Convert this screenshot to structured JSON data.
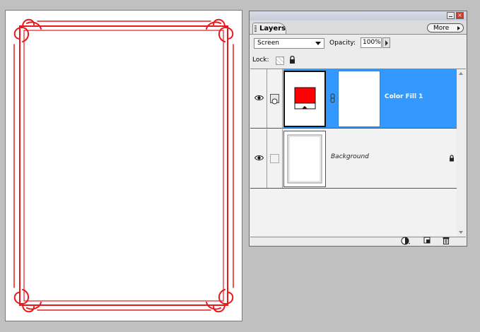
{
  "panel": {
    "tab_label": "Layers",
    "more_label": "More",
    "blend_mode": "Screen",
    "opacity_label": "Opacity:",
    "opacity_value": "100%",
    "lock_label": "Lock:"
  },
  "layers": [
    {
      "name": "Color Fill 1",
      "selected": true,
      "visible": true
    },
    {
      "name": "Background",
      "selected": false,
      "visible": true,
      "locked": true
    }
  ],
  "colors": {
    "frame": "#e8191d",
    "selection": "#3399ff",
    "fill_swatch": "#ff0000"
  },
  "icons": [
    "eye-icon",
    "chain-icon",
    "lock-icon",
    "new-fill-layer-icon",
    "new-layer-icon",
    "trash-icon",
    "close-icon",
    "minimize-icon"
  ]
}
